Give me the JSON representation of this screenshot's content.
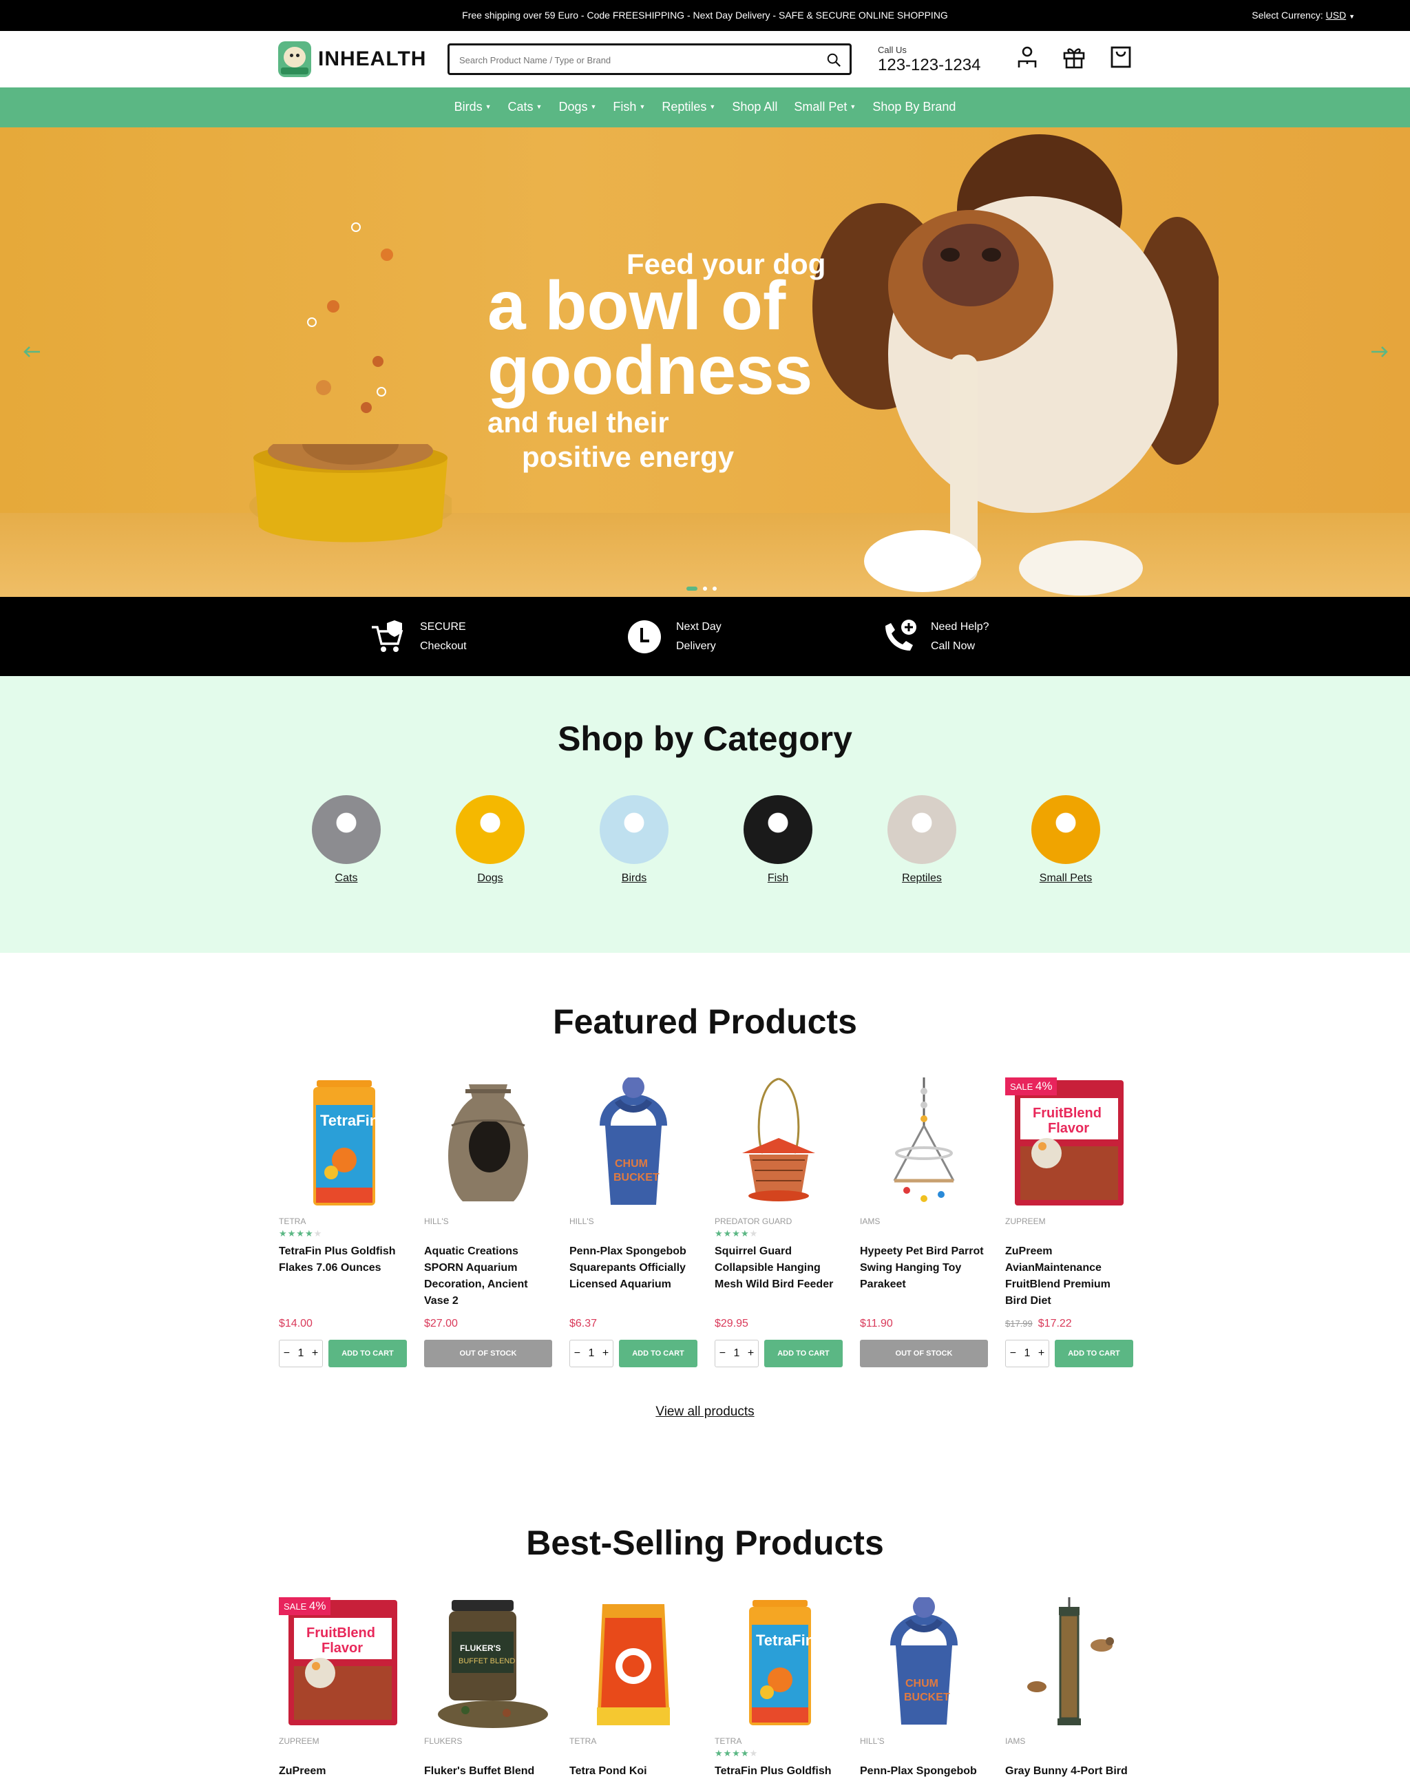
{
  "topbar": {
    "message": "Free shipping over 59 Euro - Code FREESHIPPING - Next Day Delivery - SAFE & SECURE ONLINE SHOPPING",
    "currency_label": "Select Currency:",
    "currency_value": "USD"
  },
  "header": {
    "logo_text": "INHEALTH",
    "search_placeholder": "Search Product Name / Type or Brand",
    "call_label": "Call Us",
    "phone": "123-123-1234"
  },
  "nav": {
    "items": [
      {
        "label": "Birds",
        "dropdown": true
      },
      {
        "label": "Cats",
        "dropdown": true
      },
      {
        "label": "Dogs",
        "dropdown": true
      },
      {
        "label": "Fish",
        "dropdown": true
      },
      {
        "label": "Reptiles",
        "dropdown": true
      },
      {
        "label": "Shop All",
        "dropdown": false
      },
      {
        "label": "Small Pet",
        "dropdown": true
      },
      {
        "label": "Shop By Brand",
        "dropdown": false
      }
    ]
  },
  "hero": {
    "line1": "Feed your dog",
    "line2a": "a bowl of",
    "line2b": "goodness",
    "line3": "and fuel their",
    "line4": "positive energy",
    "slide_count": 3,
    "active_slide": 1
  },
  "features": [
    {
      "line1": "SECURE",
      "line2": "Checkout",
      "icon": "cart-shield-icon"
    },
    {
      "line1": "Next Day",
      "line2": "Delivery",
      "icon": "clock-icon"
    },
    {
      "line1": "Need Help?",
      "line2": "Call Now",
      "icon": "phone-plus-icon"
    }
  ],
  "categories": {
    "title": "Shop by Category",
    "items": [
      {
        "label": "Cats",
        "color": "#8c8c90"
      },
      {
        "label": "Dogs",
        "color": "#f5b800"
      },
      {
        "label": "Birds",
        "color": "#bfe0ef"
      },
      {
        "label": "Fish",
        "color": "#1a1a1a"
      },
      {
        "label": "Reptiles",
        "color": "#d8d0c8"
      },
      {
        "label": "Small Pets",
        "color": "#f0a400"
      }
    ]
  },
  "featured": {
    "title": "Featured Products",
    "view_all": "View all products",
    "products": [
      {
        "brand": "TETRA",
        "rating": 4,
        "name": "TetraFin Plus Goldfish Flakes 7.06 Ounces",
        "price": "$14.00",
        "old_price": "",
        "sale": "",
        "in_stock": true,
        "qty": "1",
        "art": "tetra"
      },
      {
        "brand": "HILL'S",
        "rating": 0,
        "name": "Aquatic Creations SPORN Aquarium Decoration, Ancient Vase 2",
        "price": "$27.00",
        "old_price": "",
        "sale": "",
        "in_stock": false,
        "qty": "1",
        "art": "vase"
      },
      {
        "brand": "HILL'S",
        "rating": 0,
        "name": "Penn-Plax Spongebob Squarepants Officially Licensed Aquarium",
        "price": "$6.37",
        "old_price": "",
        "sale": "",
        "in_stock": true,
        "qty": "1",
        "art": "sponge"
      },
      {
        "brand": "PREDATOR GUARD",
        "rating": 4,
        "name": "Squirrel Guard Collapsible Hanging Mesh Wild Bird Feeder",
        "price": "$29.95",
        "old_price": "",
        "sale": "",
        "in_stock": true,
        "qty": "1",
        "art": "feeder"
      },
      {
        "brand": "IAMS",
        "rating": 0,
        "name": "Hypeety Pet Bird Parrot Swing Hanging Toy Parakeet",
        "price": "$11.90",
        "old_price": "",
        "sale": "",
        "in_stock": false,
        "qty": "1",
        "art": "swing"
      },
      {
        "brand": "ZUPREEM",
        "rating": 0,
        "name": "ZuPreem AvianMaintenance FruitBlend Premium Bird Diet",
        "price": "$17.22",
        "old_price": "$17.99",
        "sale": "4%",
        "in_stock": true,
        "qty": "1",
        "art": "zupreem"
      }
    ]
  },
  "bestselling": {
    "title": "Best-Selling Products",
    "products": [
      {
        "brand": "ZUPREEM",
        "rating": 0,
        "name": "ZuPreem",
        "sale": "4%",
        "art": "zupreem"
      },
      {
        "brand": "FLUKERS",
        "rating": 0,
        "name": "Fluker's Buffet Blend",
        "sale": "",
        "art": "flukers"
      },
      {
        "brand": "TETRA",
        "rating": 0,
        "name": "Tetra Pond Koi",
        "sale": "",
        "art": "koi"
      },
      {
        "brand": "TETRA",
        "rating": 4,
        "name": "TetraFin Plus Goldfish",
        "sale": "",
        "art": "tetra"
      },
      {
        "brand": "HILL'S",
        "rating": 0,
        "name": "Penn-Plax Spongebob",
        "sale": "",
        "art": "sponge"
      },
      {
        "brand": "IAMS",
        "rating": 0,
        "name": "Gray Bunny 4-Port Bird",
        "sale": "",
        "art": "tube"
      }
    ]
  },
  "labels": {
    "add_to_cart": "ADD TO CART",
    "out_of_stock": "OUT OF STOCK",
    "sale": "SALE"
  },
  "colors": {
    "accent": "#5bb784",
    "sale": "#e8245c",
    "price": "#d93a5a",
    "hero_bg": "#e9ad44",
    "category_bg": "#e3fbeb"
  }
}
